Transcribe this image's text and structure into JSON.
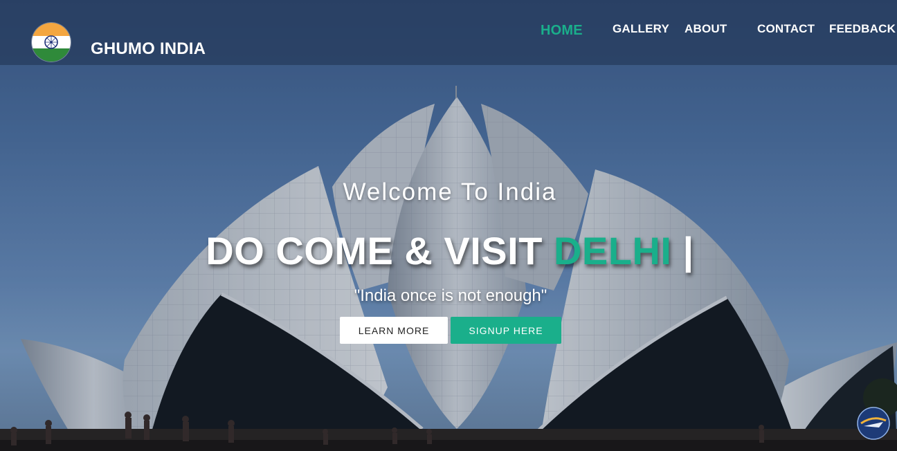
{
  "header": {
    "brand": "GHUMO INDIA",
    "nav": [
      {
        "label": "HOME",
        "active": true
      },
      {
        "label": "GALLERY",
        "active": false
      },
      {
        "label": "ABOUT",
        "active": false
      },
      {
        "label": "CONTACT",
        "active": false
      },
      {
        "label": "FEEDBACK",
        "active": false
      }
    ]
  },
  "hero": {
    "welcome": "Welcome To India",
    "headline_prefix": "DO COME & VISIT ",
    "headline_accent": "DELHI",
    "headline_cursor": " |",
    "tagline": "\"India once is not enough\"",
    "learn_more_label": "LEARN MORE",
    "signup_label": "SIGNUP HERE"
  },
  "colors": {
    "accent": "#1aaf8b",
    "header_bg": "#263a5c",
    "button_light": "#ffffff",
    "text": "#ffffff"
  },
  "icons": {
    "logo": "india-flag-emblem-icon",
    "badge": "travel-badge-icon"
  }
}
